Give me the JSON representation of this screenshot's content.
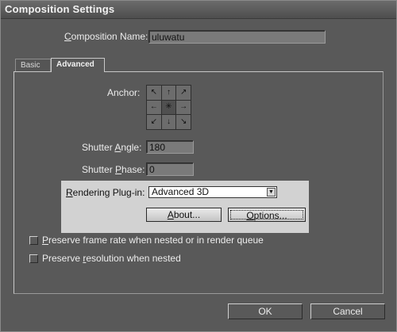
{
  "window": {
    "title": "Composition Settings"
  },
  "comp_name": {
    "label_prefix": "C",
    "label_rest": "omposition Name:",
    "value": "uluwatu"
  },
  "tabs": [
    {
      "label": "Basic",
      "active": false
    },
    {
      "label": "Advanced",
      "active": true
    }
  ],
  "anchor": {
    "label": "Anchor:",
    "cells": [
      "↖",
      "↑",
      "↗",
      "←",
      "✳",
      "→",
      "↙",
      "↓",
      "↘"
    ]
  },
  "shutter_angle": {
    "label_pre": "Shutter ",
    "label_key": "A",
    "label_post": "ngle:",
    "value": "180"
  },
  "shutter_phase": {
    "label_pre": "Shutter ",
    "label_key": "P",
    "label_post": "hase:",
    "value": "0"
  },
  "rendering": {
    "label_key": "R",
    "label_rest": "endering Plug-in:",
    "selected": "Advanced 3D",
    "about_key": "A",
    "about_rest": "bout...",
    "options_key": "O",
    "options_rest": "ptions..."
  },
  "checkboxes": [
    {
      "label_key": "P",
      "label_rest": "reserve frame rate when nested or in render queue",
      "checked": false
    },
    {
      "label_pre": "Preserve ",
      "label_key": "r",
      "label_post": "esolution when nested",
      "checked": false
    }
  ],
  "buttons": {
    "ok": "OK",
    "cancel": "Cancel"
  },
  "colors": {
    "window_bg": "#595959",
    "title_bg": "#4e4e4e",
    "highlight_bg": "#d2d2d2"
  }
}
